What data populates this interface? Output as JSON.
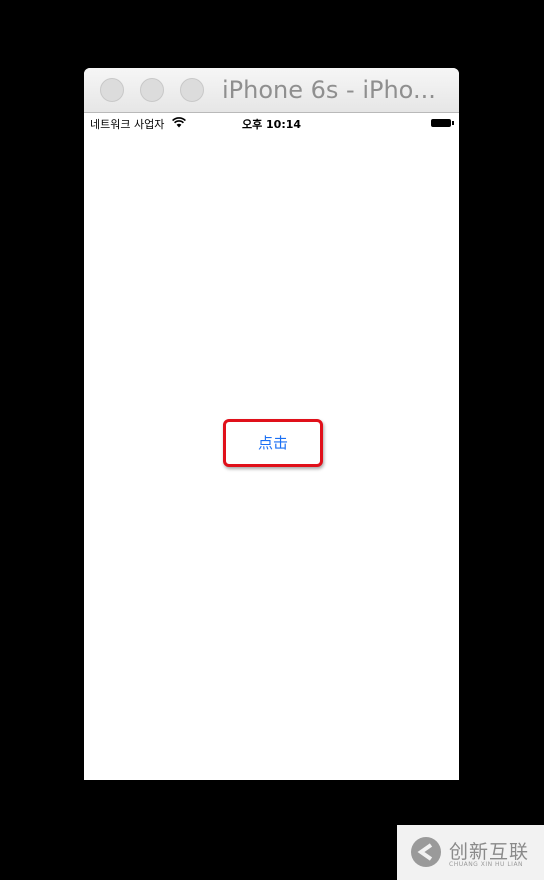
{
  "window": {
    "title": "iPhone 6s - iPho..."
  },
  "statusbar": {
    "carrier": "네트워크 사업자",
    "time": "오후 10:14",
    "wifi_icon": "wifi-icon",
    "battery_icon": "battery-icon"
  },
  "main": {
    "button_label": "点击",
    "button_color": "#1a6ff4",
    "highlight_color": "#e0101a"
  },
  "watermark": {
    "brand": "创新互联",
    "subtitle": "CHUANG XIN HU LIAN"
  }
}
